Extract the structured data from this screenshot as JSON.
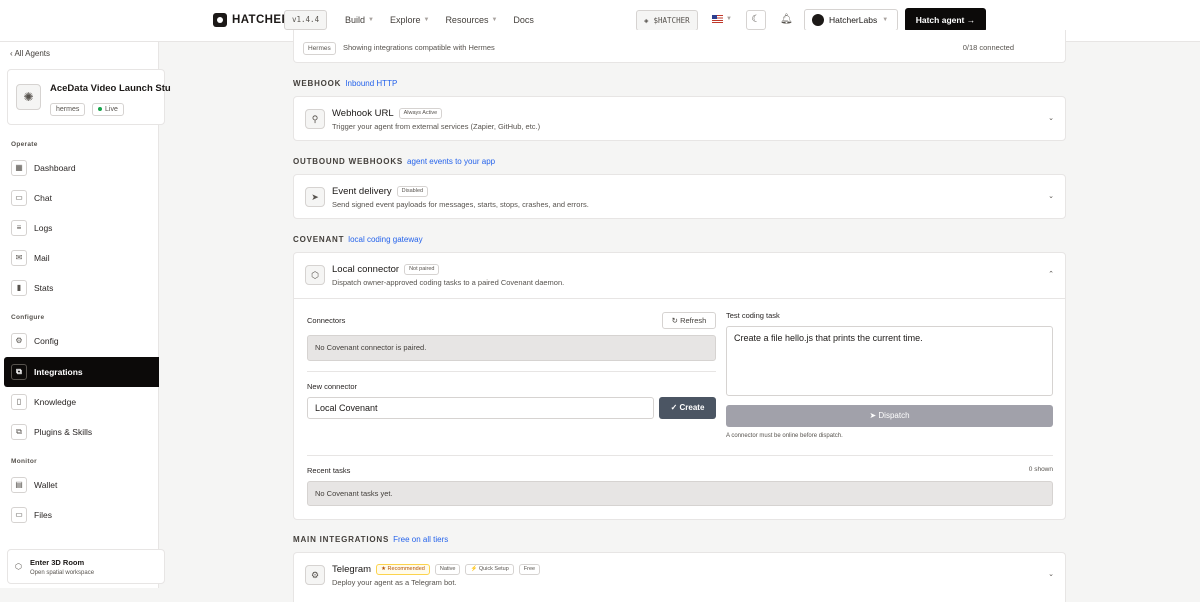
{
  "topbar": {
    "logo_text": "HATCHER",
    "version": "v1.4.4",
    "nav": [
      "Build",
      "Explore",
      "Resources",
      "Docs"
    ],
    "token_label": "$HATCHER",
    "user_name": "HatcherLabs",
    "hatch_button": "Hatch agent",
    "hatch_arrow": "→"
  },
  "sidebar": {
    "back_link": "All Agents",
    "agent_name": "AceData Video Launch Stu",
    "agent_framework": "hermes",
    "agent_status": "Live",
    "groups": {
      "operate": "Operate",
      "configure": "Configure",
      "monitor": "Monitor"
    },
    "items": {
      "dashboard": "Dashboard",
      "chat": "Chat",
      "logs": "Logs",
      "mail": "Mail",
      "stats": "Stats",
      "config": "Config",
      "integrations": "Integrations",
      "knowledge": "Knowledge",
      "plugins": "Plugins & Skills",
      "wallet": "Wallet",
      "files": "Files"
    },
    "room_title": "Enter 3D Room",
    "room_subtitle": "Open spatial workspace"
  },
  "filter": {
    "tag": "Hermes",
    "text": "Showing integrations compatible with Hermes",
    "connected": "0/18 connected"
  },
  "webhook": {
    "section": "WEBHOOK",
    "section_sub": "Inbound HTTP",
    "title": "Webhook URL",
    "badge": "Always Active",
    "desc": "Trigger your agent from external services (Zapier, GitHub, etc.)"
  },
  "outbound": {
    "section": "OUTBOUND WEBHOOKS",
    "section_sub": "agent events to your app",
    "title": "Event delivery",
    "badge": "Disabled",
    "desc": "Send signed event payloads for messages, starts, stops, crashes, and errors."
  },
  "covenant": {
    "section": "COVENANT",
    "section_sub": "local coding gateway",
    "title": "Local connector",
    "badge": "Not paired",
    "desc": "Dispatch owner-approved coding tasks to a paired Covenant daemon.",
    "connectors_label": "Connectors",
    "refresh": "Refresh",
    "connectors_empty": "No Covenant connector is paired.",
    "new_connector_label": "New connector",
    "new_connector_value": "Local Covenant",
    "create": "Create",
    "test_task_label": "Test coding task",
    "test_task_value": "Create a file hello.js that prints the current time.",
    "dispatch": "Dispatch",
    "dispatch_hint": "A connector must be online before dispatch.",
    "recent_label": "Recent tasks",
    "recent_count": "0 shown",
    "recent_empty": "No Covenant tasks yet."
  },
  "main": {
    "section": "MAIN INTEGRATIONS",
    "section_sub": "Free on all tiers",
    "telegram_title": "Telegram",
    "badges": [
      "Recommended",
      "Native",
      "Quick Setup",
      "Free"
    ],
    "telegram_desc": "Deploy your agent as a Telegram bot."
  }
}
